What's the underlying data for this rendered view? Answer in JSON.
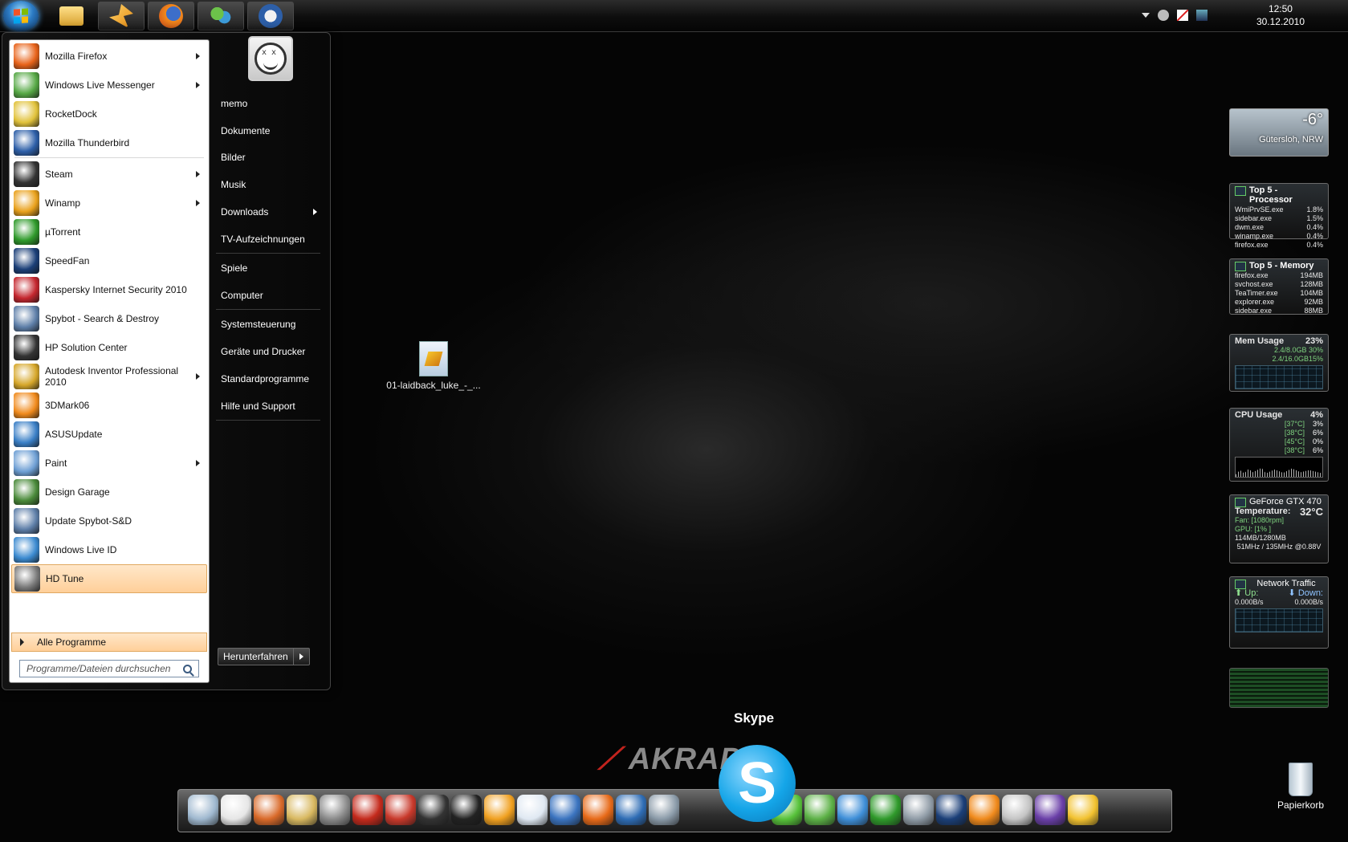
{
  "taskbar": {
    "clock": {
      "time": "12:50",
      "date": "30.12.2010"
    },
    "pinned": [
      {
        "name": "start-orb"
      },
      {
        "name": "explorer",
        "color": "#f4c24b"
      },
      {
        "name": "winamp",
        "color": "#f0a020"
      },
      {
        "name": "firefox",
        "color": "#e76a19"
      },
      {
        "name": "messenger",
        "color": "#5cb146"
      },
      {
        "name": "thunderbird",
        "color": "#3b74c0"
      }
    ]
  },
  "start_menu": {
    "programs": [
      {
        "label": "Mozilla Firefox",
        "submenu": true,
        "icon": "firefox-icon",
        "color": "#e8631a"
      },
      {
        "label": "Windows Live Messenger",
        "submenu": true,
        "icon": "messenger-icon",
        "color": "#56a845"
      },
      {
        "label": "RocketDock",
        "submenu": false,
        "icon": "rocketdock-icon",
        "color": "#e1c23b"
      },
      {
        "label": "Mozilla Thunderbird",
        "submenu": false,
        "icon": "thunderbird-icon",
        "color": "#2d5fa8"
      },
      {
        "label": "Steam",
        "submenu": true,
        "icon": "steam-icon",
        "color": "#333333"
      },
      {
        "label": "Winamp",
        "submenu": true,
        "icon": "winamp-icon",
        "color": "#e9a11c"
      },
      {
        "label": "µTorrent",
        "submenu": false,
        "icon": "utorrent-icon",
        "color": "#2f9a2b"
      },
      {
        "label": "SpeedFan",
        "submenu": false,
        "icon": "speedfan-icon",
        "color": "#1b3f78"
      },
      {
        "label": "Kaspersky Internet Security 2010",
        "submenu": false,
        "icon": "kaspersky-icon",
        "color": "#c4262e"
      },
      {
        "label": "Spybot - Search & Destroy",
        "submenu": false,
        "icon": "spybot-icon",
        "color": "#5d7ea8"
      },
      {
        "label": "HP Solution Center",
        "submenu": false,
        "icon": "hp-icon",
        "color": "#333333"
      },
      {
        "label": "Autodesk Inventor Professional 2010",
        "submenu": true,
        "icon": "inventor-icon",
        "color": "#d6a72a"
      },
      {
        "label": "3DMark06",
        "submenu": false,
        "icon": "3dmark-icon",
        "color": "#f08a1c"
      },
      {
        "label": "ASUSUpdate",
        "submenu": false,
        "icon": "asus-icon",
        "color": "#3a7fc6"
      },
      {
        "label": "Paint",
        "submenu": true,
        "icon": "paint-icon",
        "color": "#6e9fd4"
      },
      {
        "label": "Design Garage",
        "submenu": false,
        "icon": "design-garage-icon",
        "color": "#4a8a3a"
      },
      {
        "label": "Update Spybot-S&D",
        "submenu": false,
        "icon": "spybot-update-icon",
        "color": "#5d7ea8"
      },
      {
        "label": "Windows Live ID",
        "submenu": false,
        "icon": "live-id-icon",
        "color": "#3b8ad0"
      },
      {
        "label": "HD Tune",
        "submenu": false,
        "icon": "hdtune-icon",
        "color": "#7a7a7a",
        "highlighted": true
      }
    ],
    "all_programs": "Alle Programme",
    "search_placeholder": "Programme/Dateien durchsuchen",
    "places": [
      {
        "label": "memo",
        "submenu": false
      },
      {
        "label": "Dokumente",
        "submenu": false
      },
      {
        "label": "Bilder",
        "submenu": false
      },
      {
        "label": "Musik",
        "submenu": false
      },
      {
        "label": "Downloads",
        "submenu": true
      },
      {
        "label": "TV-Aufzeichnungen",
        "submenu": false
      },
      {
        "label": "Spiele",
        "submenu": false
      },
      {
        "label": "Computer",
        "submenu": false
      },
      {
        "label": "Systemsteuerung",
        "submenu": false
      },
      {
        "label": "Geräte und Drucker",
        "submenu": false
      },
      {
        "label": "Standardprogramme",
        "submenu": false
      },
      {
        "label": "Hilfe und Support",
        "submenu": false
      }
    ],
    "shutdown": "Herunterfahren"
  },
  "desktop": {
    "file_label": "01-laidback_luke_-_...",
    "recycle_bin": "Papierkorb",
    "skype_label": "Skype",
    "wallpaper_text": "AKRAPO"
  },
  "gadgets": {
    "weather": {
      "temp": "-6°",
      "location": "Gütersloh, NRW"
    },
    "top_processor": {
      "title": "Top 5 - Processor",
      "rows": [
        {
          "name": "WmiPrvSE.exe",
          "value": "1.8%"
        },
        {
          "name": "sidebar.exe",
          "value": "1.5%"
        },
        {
          "name": "dwm.exe",
          "value": "0.4%"
        },
        {
          "name": "winamp.exe",
          "value": "0.4%"
        },
        {
          "name": "firefox.exe",
          "value": "0.4%"
        }
      ]
    },
    "top_memory": {
      "title": "Top 5 - Memory",
      "rows": [
        {
          "name": "firefox.exe",
          "value": "194MB"
        },
        {
          "name": "svchost.exe",
          "value": "128MB"
        },
        {
          "name": "TeaTimer.exe",
          "value": "104MB"
        },
        {
          "name": "explorer.exe",
          "value": "92MB"
        },
        {
          "name": "sidebar.exe",
          "value": "88MB"
        }
      ]
    },
    "mem_usage": {
      "title": "Mem Usage",
      "percent": "23%",
      "line1": "2.4/8.0GB 30%",
      "line2": "2.4/16.0GB15%"
    },
    "cpu_usage": {
      "title": "CPU Usage",
      "percent": "4%",
      "cores": [
        {
          "temp": "[37°C]",
          "load": "3%"
        },
        {
          "temp": "[38°C]",
          "load": "6%"
        },
        {
          "temp": "[45°C]",
          "load": "0%"
        },
        {
          "temp": "[38°C]",
          "load": "6%"
        }
      ]
    },
    "gpu": {
      "title": "GeForce GTX 470",
      "temp_label": "Temperature:",
      "temp_value": "32°C",
      "fan": "Fan: [1080rpm]",
      "gpu_load": "GPU: [1% ]",
      "mem": "114MB/1280MB",
      "clock": "51MHz / 135MHz @0.88V"
    },
    "network": {
      "title": "Network Traffic",
      "up_label": "Up:",
      "down_label": "Down:",
      "up_value": "0.000B/s",
      "down_value": "0.000B/s"
    }
  },
  "dock": {
    "icons": [
      {
        "name": "notes-icon",
        "color": "#9fb8cf"
      },
      {
        "name": "textedit-icon",
        "color": "#e6e6e6"
      },
      {
        "name": "colosseum-icon",
        "color": "#d96a2a"
      },
      {
        "name": "palette-icon",
        "color": "#d8b860"
      },
      {
        "name": "moto-cape-icon",
        "color": "#8a8a8a"
      },
      {
        "name": "red-app-icon",
        "color": "#c42a1c"
      },
      {
        "name": "alarm-clock-icon",
        "color": "#c8392b"
      },
      {
        "name": "need-for-speed-icon",
        "color": "#333333"
      },
      {
        "name": "steam-icon",
        "color": "#222222"
      },
      {
        "name": "winamp-icon",
        "color": "#f0a020"
      },
      {
        "name": "document-icon",
        "color": "#dfe8f2"
      },
      {
        "name": "thunderbird-icon",
        "color": "#3b74c0"
      },
      {
        "name": "firefox-icon",
        "color": "#e76a19"
      },
      {
        "name": "google-earth-icon",
        "color": "#2f6db5"
      },
      {
        "name": "vlc-icon",
        "color": "#8a9aa8"
      },
      {
        "name": "icq-icon",
        "color": "#57c23a"
      },
      {
        "name": "messenger-icon",
        "color": "#5cb146"
      },
      {
        "name": "lightning-icon",
        "color": "#3f8fd8"
      },
      {
        "name": "utorrent-icon",
        "color": "#2f9a2b"
      },
      {
        "name": "speaker-icon",
        "color": "#8f9ba6"
      },
      {
        "name": "speedfan-icon",
        "color": "#1b3f78"
      },
      {
        "name": "3dmark-icon",
        "color": "#f08a1c"
      },
      {
        "name": "cube-icon",
        "color": "#c4c4c4"
      },
      {
        "name": "cpu-z-icon",
        "color": "#6a3fa8"
      },
      {
        "name": "honeycomb-icon",
        "color": "#f2c230"
      }
    ]
  }
}
